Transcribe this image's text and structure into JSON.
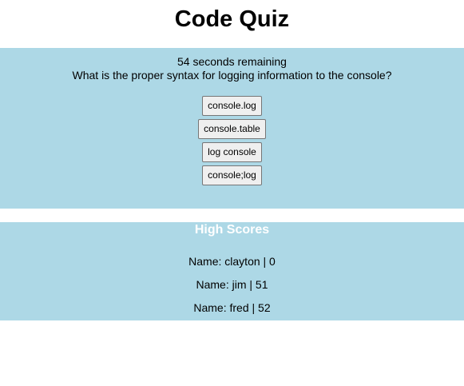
{
  "header": {
    "title": "Code Quiz"
  },
  "quiz": {
    "timer_text": "54 seconds remaining",
    "question": "What is the proper syntax for logging information to the console?",
    "answers": [
      "console.log",
      "console.table",
      "log console",
      "console;log"
    ]
  },
  "high_scores": {
    "title": "High Scores",
    "entries": [
      "Name: clayton | 0",
      "Name: jim | 51",
      "Name: fred | 52"
    ]
  },
  "colors": {
    "panel_background": "#add8e6",
    "page_background": "#ffffff",
    "heading_text": "#000000",
    "scores_title_text": "#ffffff",
    "button_background": "#efefef",
    "button_border": "#767676"
  }
}
